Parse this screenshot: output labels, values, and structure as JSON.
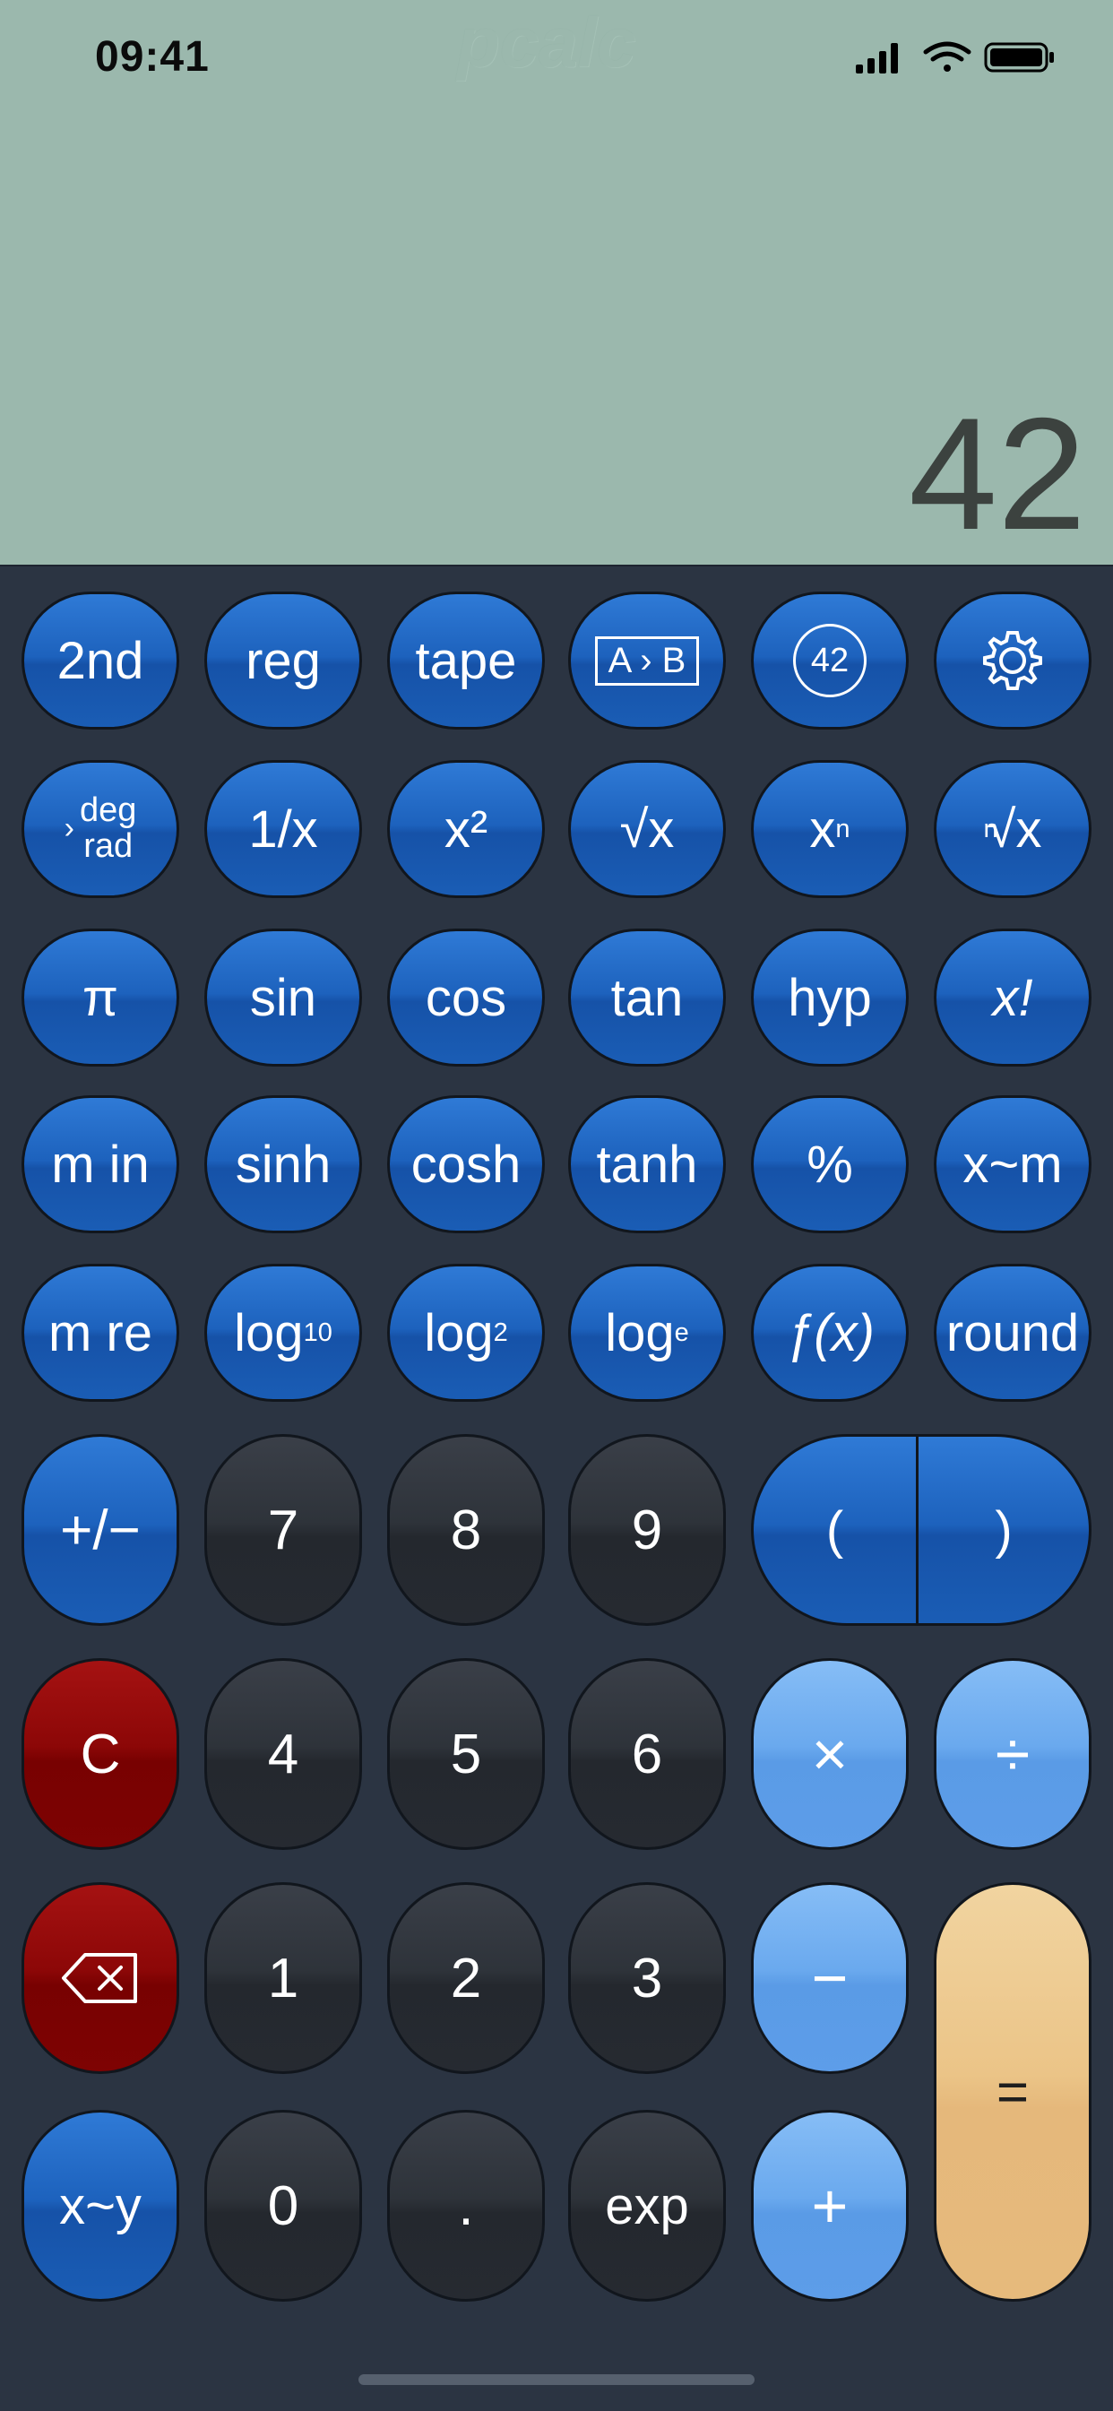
{
  "status_bar": {
    "time": "09:41"
  },
  "display": {
    "watermark": "pcalc",
    "value": "42"
  },
  "icons": [
    "gear-icon",
    "backspace-icon",
    "signal-icon",
    "wifi-icon",
    "battery-icon"
  ],
  "colors": {
    "display_bg": "#9bb8ad",
    "keypad_bg": "#2b3442",
    "blue": "#1d62bd",
    "light_blue": "#6aa9ee",
    "red": "#8c0707",
    "equals": "#ebc487"
  },
  "keys": {
    "second": "2nd",
    "reg": "reg",
    "tape": "tape",
    "ab": "A › B",
    "badge": "42",
    "deg": "deg",
    "rad": "rad",
    "reciprocal": "1/x",
    "x_squared": "x²",
    "sqrt": "√x",
    "x_pow_n_base": "x",
    "x_pow_n_exp": "n",
    "nth_root_index": "n",
    "nth_root_body": "√x",
    "pi": "π",
    "sin": "sin",
    "cos": "cos",
    "tan": "tan",
    "hyp": "hyp",
    "factorial": "x!",
    "m_in": "m in",
    "sinh": "sinh",
    "cosh": "cosh",
    "tanh": "tanh",
    "percent": "%",
    "x_m": "x~m",
    "m_re": "m re",
    "log": "log",
    "log10_sub": "10",
    "log2_sub": "2",
    "loge_sub": "e",
    "fx": "ƒ(x)",
    "round": "round",
    "plus_minus": "+/−",
    "seven": "7",
    "eight": "8",
    "nine": "9",
    "lparen": "(",
    "rparen": ")",
    "clear": "C",
    "four": "4",
    "five": "5",
    "six": "6",
    "multiply": "×",
    "divide": "÷",
    "one": "1",
    "two": "2",
    "three": "3",
    "minus": "−",
    "equals": "=",
    "swap": "x~y",
    "zero": "0",
    "point": ".",
    "exp": "exp",
    "plus": "+"
  }
}
